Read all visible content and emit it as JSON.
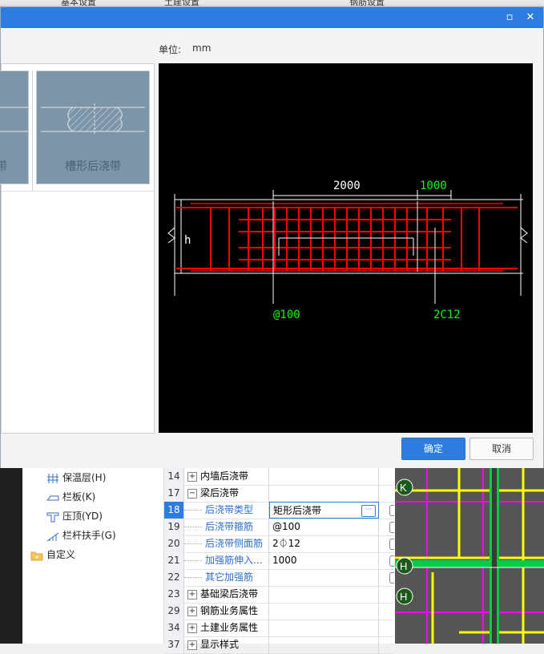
{
  "background_tabs": [
    "基本设置",
    "土建设置",
    "钢筋设置"
  ],
  "dialog": {
    "maximize_icon": "maximize-icon",
    "close_icon": "close-icon",
    "unit_label": "单位:",
    "unit_value": "mm",
    "thumbnails": [
      {
        "label": "带"
      },
      {
        "label": "槽形后浇带"
      }
    ],
    "drawing": {
      "dim_1": "2000",
      "dim_2": "1000",
      "h_label": "h",
      "stirrup_spacing": "@100",
      "side_bar": "2C12"
    },
    "ok_label": "确定",
    "cancel_label": "取消"
  },
  "tree": [
    {
      "label": "保温层(H)",
      "icon": "insulation-icon"
    },
    {
      "label": "栏板(K)",
      "icon": "parapet-icon"
    },
    {
      "label": "压顶(YD)",
      "icon": "coping-icon"
    },
    {
      "label": "栏杆扶手(G)",
      "icon": "railing-icon"
    },
    {
      "label": "自定义",
      "icon": "folder-icon"
    }
  ],
  "properties": [
    {
      "num": "14",
      "expander": "+",
      "name": "内墙后浇带",
      "value": "",
      "child": false
    },
    {
      "num": "17",
      "expander": "−",
      "name": "梁后浇带",
      "value": "",
      "child": false
    },
    {
      "num": "18",
      "expander": "",
      "name": "后浇带类型",
      "value": "矩形后浇带",
      "child": true,
      "selected": true
    },
    {
      "num": "19",
      "expander": "",
      "name": "后浇带箍筋",
      "value": "@100",
      "child": true
    },
    {
      "num": "20",
      "expander": "",
      "name": "后浇带侧面筋",
      "value": "2⏀12",
      "child": true
    },
    {
      "num": "21",
      "expander": "",
      "name": "加强筋伸入...",
      "value": "1000",
      "child": true
    },
    {
      "num": "22",
      "expander": "",
      "name": "其它加强筋",
      "value": "",
      "child": true
    },
    {
      "num": "23",
      "expander": "+",
      "name": "基础梁后浇带",
      "value": "",
      "child": false
    },
    {
      "num": "29",
      "expander": "+",
      "name": "钢筋业务属性",
      "value": "",
      "child": false
    },
    {
      "num": "34",
      "expander": "+",
      "name": "土建业务属性",
      "value": "",
      "child": false
    },
    {
      "num": "37",
      "expander": "+",
      "name": "显示样式",
      "value": "",
      "child": false
    }
  ],
  "cad_axis_labels": [
    "K",
    "H",
    "H"
  ],
  "colors": {
    "accent": "#2d7de0",
    "rebar_red": "#ff0000",
    "dim_green": "#00ff00",
    "cad_magenta": "#ff00ff",
    "cad_yellow": "#ffff00",
    "cad_green": "#00ff00"
  }
}
